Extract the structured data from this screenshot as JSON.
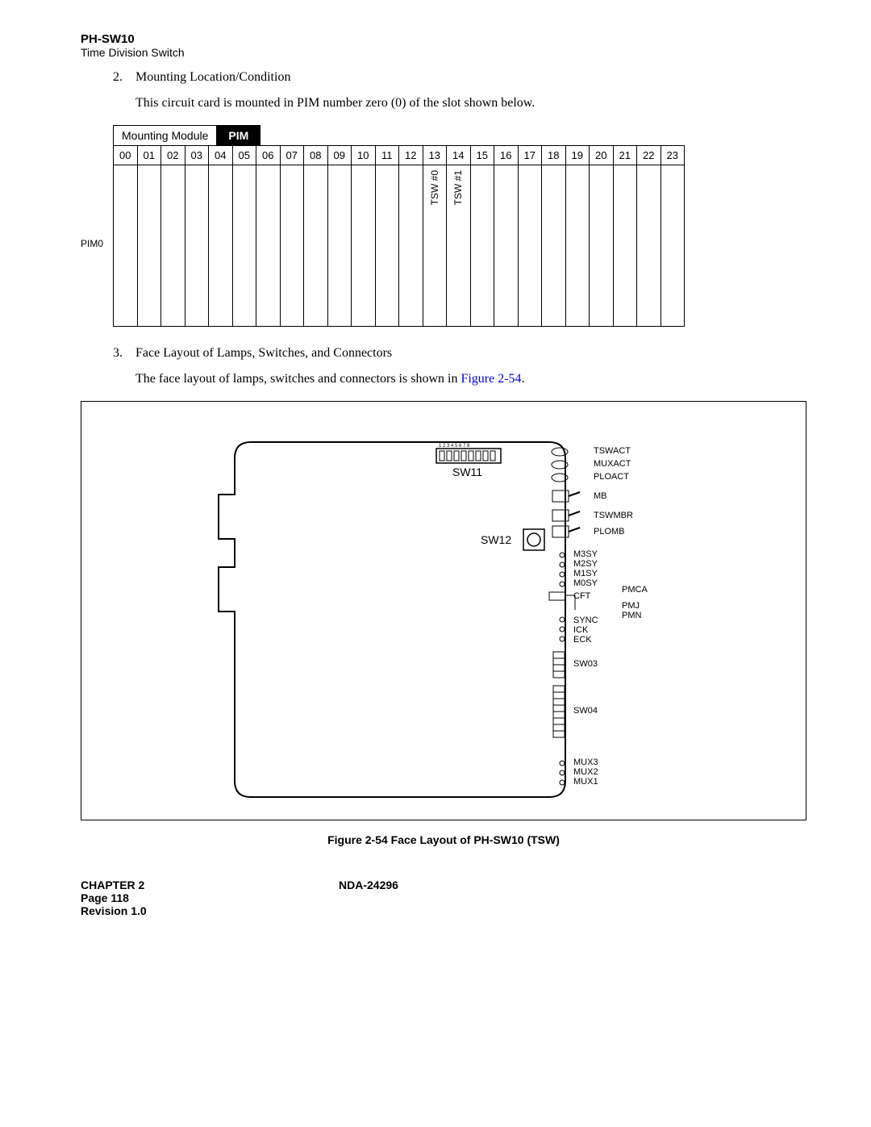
{
  "header": {
    "code": "PH-SW10",
    "subtitle": "Time Division Switch"
  },
  "section2": {
    "num": "2.",
    "title": "Mounting Location/Condition",
    "para": "This circuit card is mounted in PIM number zero (0) of the slot shown below."
  },
  "mounting": {
    "label": "Mounting Module",
    "badge": "PIM",
    "side": "PIM0",
    "slots": [
      "00",
      "01",
      "02",
      "03",
      "04",
      "05",
      "06",
      "07",
      "08",
      "09",
      "10",
      "11",
      "12",
      "13",
      "14",
      "15",
      "16",
      "17",
      "18",
      "19",
      "20",
      "21",
      "22",
      "23"
    ],
    "slot13": "TSW #0",
    "slot14": "TSW #1"
  },
  "section3": {
    "num": "3.",
    "title": "Face Layout of Lamps, Switches, and Connectors",
    "para_a": "The face layout of lamps, switches and connectors is shown in ",
    "para_link": "Figure 2-54",
    "para_b": "."
  },
  "figure": {
    "sw11": "SW11",
    "sw12": "SW12",
    "dipnums": "1 2 3 4 5 6 7 8",
    "labels": {
      "tswact": "TSWACT",
      "muxact": "MUXACT",
      "ploact": "PLOACT",
      "mb": "MB",
      "tswmbr": "TSWMBR",
      "plomb": "PLOMB",
      "m3sy": "M3SY",
      "m2sy": "M2SY",
      "m1sy": "M1SY",
      "m0sy": "M0SY",
      "cft": "CFT",
      "pmca": "PMCA",
      "pmj": "PMJ",
      "pmn": "PMN",
      "sync": "SYNC",
      "ick": "ICK",
      "eck": "ECK",
      "sw03": "SW03",
      "sw04": "SW04",
      "mux3": "MUX3",
      "mux2": "MUX2",
      "mux1": "MUX1"
    },
    "caption": "Figure 2-54   Face Layout of PH-SW10 (TSW)"
  },
  "footer": {
    "chapter": "CHAPTER 2",
    "doc": "NDA-24296",
    "page": "Page 118",
    "rev": "Revision 1.0"
  }
}
